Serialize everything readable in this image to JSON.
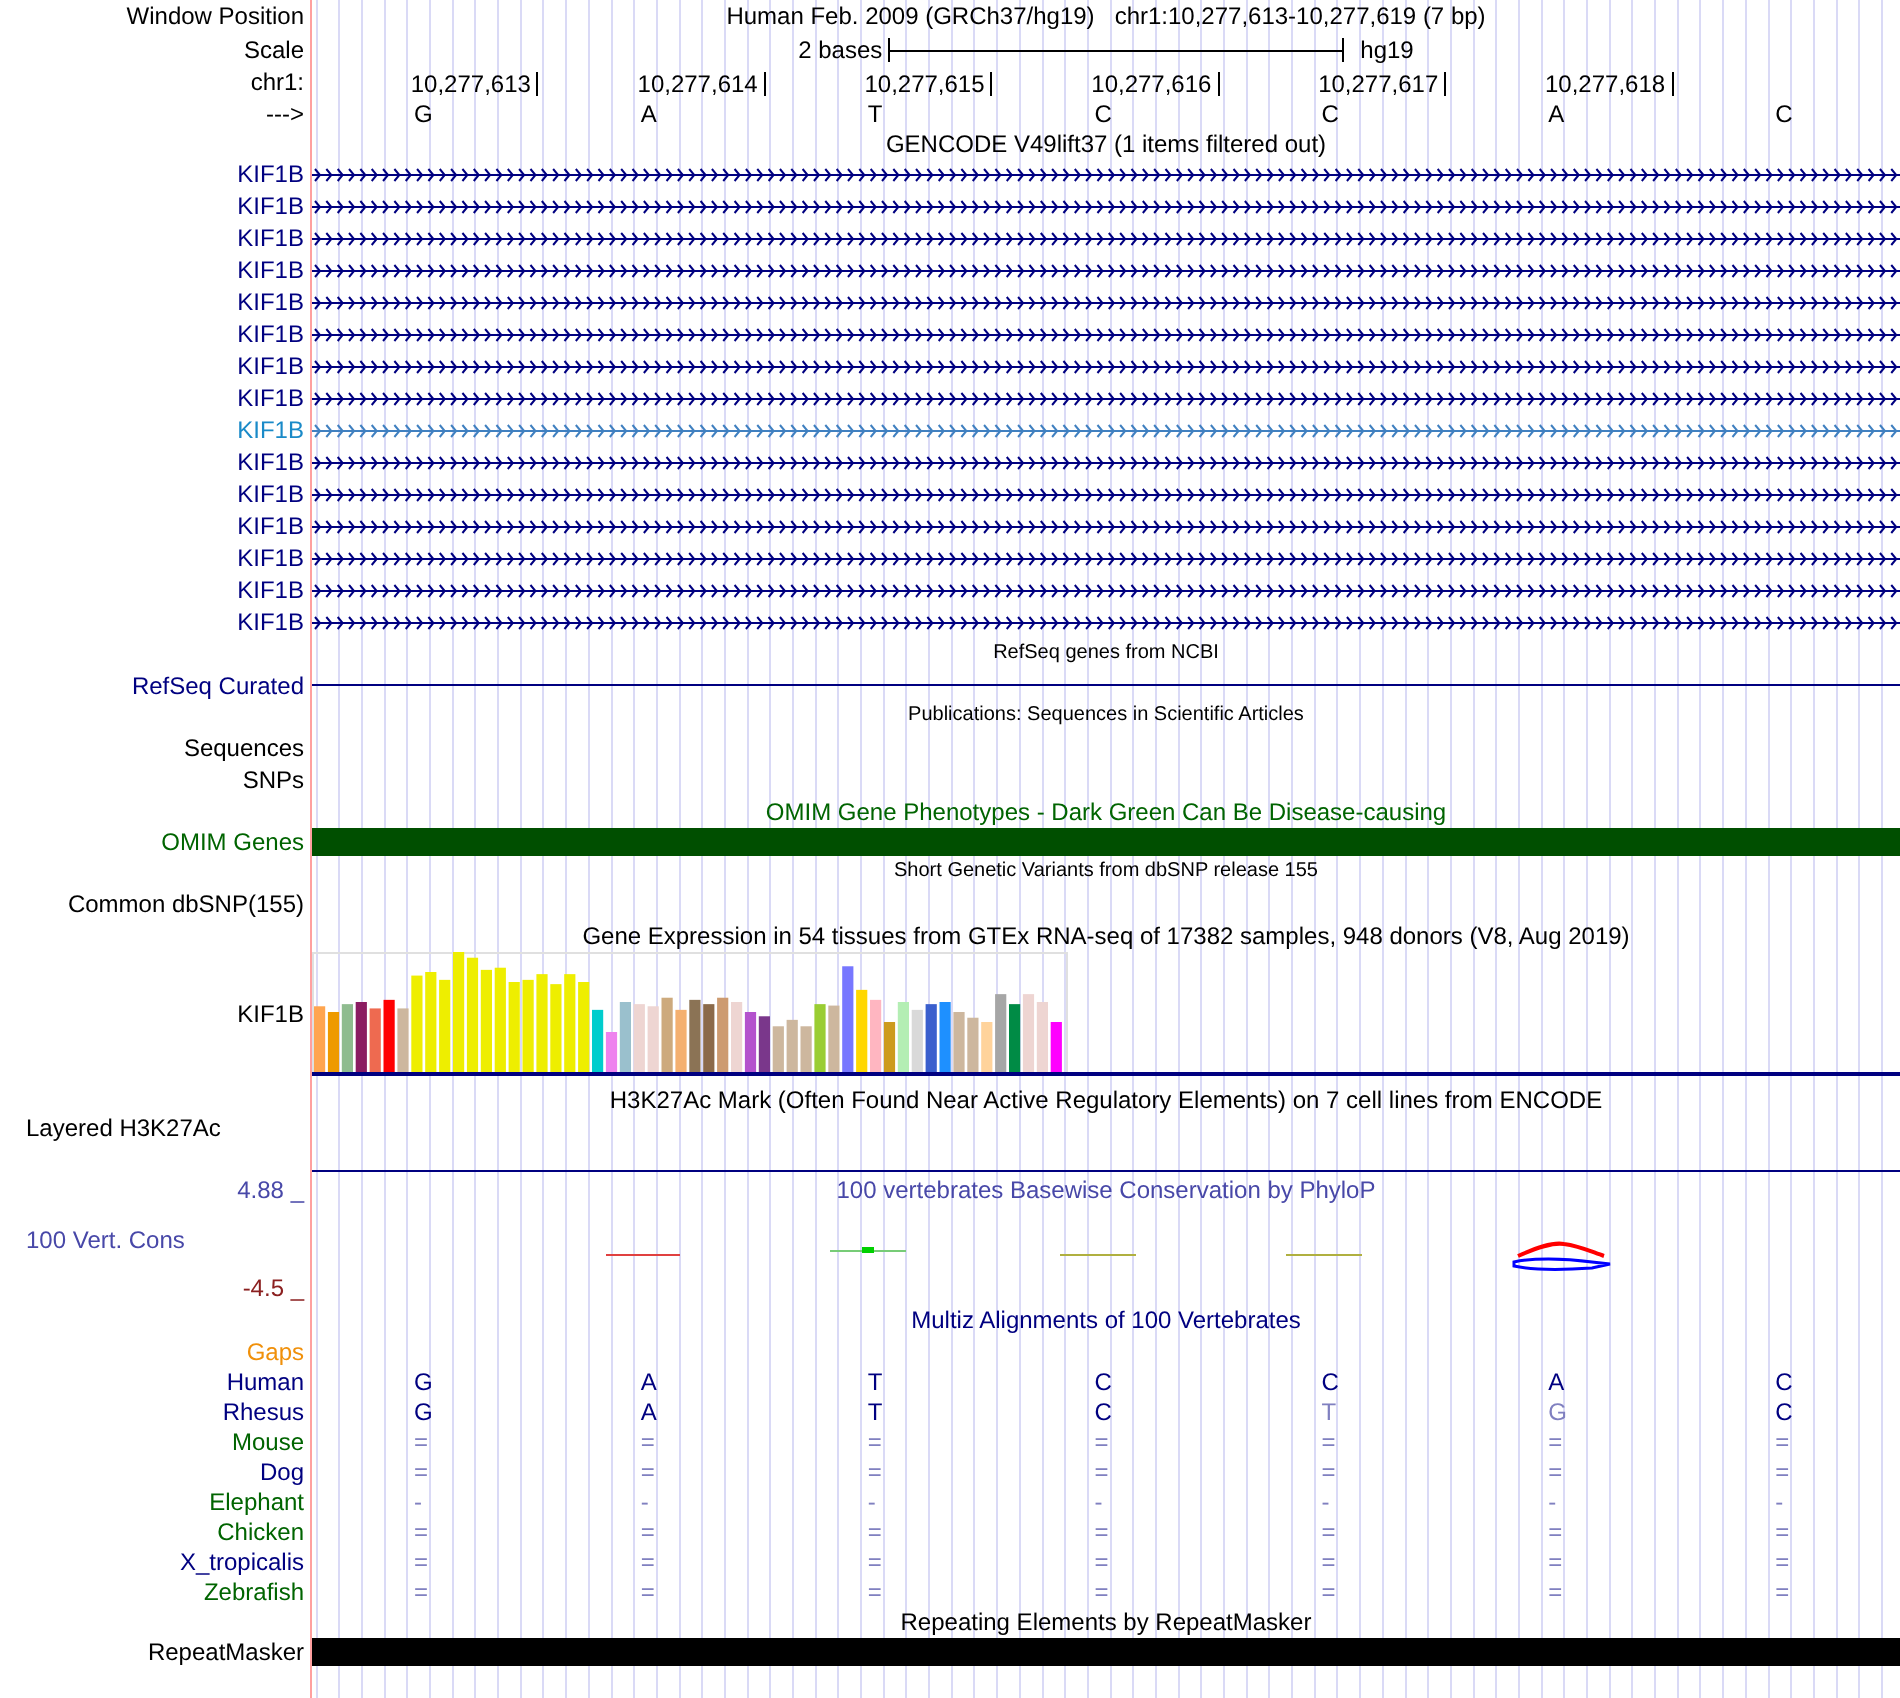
{
  "header": {
    "position_label": "Window Position",
    "assembly": "Human Feb. 2009 (GRCh37/hg19)",
    "position": "chr1:10,277,613-10,277,619 (7 bp)",
    "scale_label": "Scale",
    "scale_span": "2 bases",
    "scale_db": "hg19",
    "ruler_label": "chr1:",
    "ticks": [
      "10,277,613",
      "10,277,614",
      "10,277,615",
      "10,277,616",
      "10,277,617",
      "10,277,618"
    ],
    "strand_label": "--->",
    "bases": [
      "G",
      "A",
      "T",
      "C",
      "C",
      "A",
      "C"
    ]
  },
  "tracks": [
    {
      "kind": "genes",
      "title": "GENCODE V49lift37 (1 items filtered out)",
      "rows": [
        {
          "name": "KIF1B",
          "selected": false
        },
        {
          "name": "KIF1B",
          "selected": false
        },
        {
          "name": "KIF1B",
          "selected": false
        },
        {
          "name": "KIF1B",
          "selected": false
        },
        {
          "name": "KIF1B",
          "selected": false
        },
        {
          "name": "KIF1B",
          "selected": false
        },
        {
          "name": "KIF1B",
          "selected": false
        },
        {
          "name": "KIF1B",
          "selected": false
        },
        {
          "name": "KIF1B",
          "selected": true
        },
        {
          "name": "KIF1B",
          "selected": false
        },
        {
          "name": "KIF1B",
          "selected": false
        },
        {
          "name": "KIF1B",
          "selected": false
        },
        {
          "name": "KIF1B",
          "selected": false
        },
        {
          "name": "KIF1B",
          "selected": false
        },
        {
          "name": "KIF1B",
          "selected": false
        }
      ]
    },
    {
      "kind": "line",
      "title": "RefSeq genes from NCBI",
      "labels": [
        "RefSeq Curated"
      ]
    },
    {
      "kind": "labels",
      "title": "Publications: Sequences in Scientific Articles",
      "labels": [
        "Sequences",
        "SNPs"
      ]
    },
    {
      "kind": "bar",
      "title": "OMIM Gene Phenotypes - Dark Green Can Be Disease-causing",
      "labels": [
        "OMIM Genes"
      ]
    },
    {
      "kind": "empty",
      "title": "Short Genetic Variants from dbSNP release 155",
      "labels": [
        "Common dbSNP(155)"
      ]
    },
    {
      "kind": "expression",
      "title": "Gene Expression in 54 tissues from GTEx RNA-seq of 17382 samples, 948 donors (V8, Aug 2019)",
      "labels": [
        "KIF1B"
      ]
    },
    {
      "kind": "layered",
      "title": "H3K27Ac Mark (Often Found Near Active Regulatory Elements) on 7 cell lines from ENCODE",
      "labels": [
        "Layered H3K27Ac"
      ]
    },
    {
      "kind": "conservation",
      "title": "100 vertebrates Basewise Conservation by PhyloP",
      "labels": [
        "100 Vert. Cons"
      ],
      "max": "4.88 _",
      "min": "-4.5 _"
    },
    {
      "kind": "alignment",
      "title": "Multiz Alignments of 100 Vertebrates",
      "species": [
        {
          "name": "Gaps",
          "color": "#f0900a"
        },
        {
          "name": "Human",
          "color": "#000080",
          "bases": [
            {
              "b": "G",
              "faded": false
            },
            {
              "b": "A",
              "faded": false
            },
            {
              "b": "T",
              "faded": false
            },
            {
              "b": "C",
              "faded": false
            },
            {
              "b": "C",
              "faded": false
            },
            {
              "b": "A",
              "faded": false
            },
            {
              "b": "C",
              "faded": false
            }
          ]
        },
        {
          "name": "Rhesus",
          "color": "#000080",
          "bases": [
            {
              "b": "G",
              "faded": false
            },
            {
              "b": "A",
              "faded": false
            },
            {
              "b": "T",
              "faded": false
            },
            {
              "b": "C",
              "faded": false
            },
            {
              "b": "T",
              "faded": true
            },
            {
              "b": "G",
              "faded": true
            },
            {
              "b": "C",
              "faded": false
            }
          ]
        },
        {
          "name": "Mouse",
          "color": "#006400",
          "bases": [
            {
              "b": "=",
              "faded": true
            },
            {
              "b": "=",
              "faded": true
            },
            {
              "b": "=",
              "faded": true
            },
            {
              "b": "=",
              "faded": true
            },
            {
              "b": "=",
              "faded": true
            },
            {
              "b": "=",
              "faded": true
            },
            {
              "b": "=",
              "faded": true
            }
          ]
        },
        {
          "name": "Dog",
          "color": "#000080",
          "bases": [
            {
              "b": "=",
              "faded": true
            },
            {
              "b": "=",
              "faded": true
            },
            {
              "b": "=",
              "faded": true
            },
            {
              "b": "=",
              "faded": true
            },
            {
              "b": "=",
              "faded": true
            },
            {
              "b": "=",
              "faded": true
            },
            {
              "b": "=",
              "faded": true
            }
          ]
        },
        {
          "name": "Elephant",
          "color": "#006400",
          "bases": [
            {
              "b": "-",
              "faded": true
            },
            {
              "b": "-",
              "faded": true
            },
            {
              "b": "-",
              "faded": true
            },
            {
              "b": "-",
              "faded": true
            },
            {
              "b": "-",
              "faded": true
            },
            {
              "b": "-",
              "faded": true
            },
            {
              "b": "-",
              "faded": true
            }
          ]
        },
        {
          "name": "Chicken",
          "color": "#006400",
          "bases": [
            {
              "b": "=",
              "faded": true
            },
            {
              "b": "=",
              "faded": true
            },
            {
              "b": "=",
              "faded": true
            },
            {
              "b": "=",
              "faded": true
            },
            {
              "b": "=",
              "faded": true
            },
            {
              "b": "=",
              "faded": true
            },
            {
              "b": "=",
              "faded": true
            }
          ]
        },
        {
          "name": "X_tropicalis",
          "color": "#000080",
          "bases": [
            {
              "b": "=",
              "faded": true
            },
            {
              "b": "=",
              "faded": true
            },
            {
              "b": "=",
              "faded": true
            },
            {
              "b": "=",
              "faded": true
            },
            {
              "b": "=",
              "faded": true
            },
            {
              "b": "=",
              "faded": true
            },
            {
              "b": "=",
              "faded": true
            }
          ]
        },
        {
          "name": "Zebrafish",
          "color": "#006400",
          "bases": [
            {
              "b": "=",
              "faded": true
            },
            {
              "b": "=",
              "faded": true
            },
            {
              "b": "=",
              "faded": true
            },
            {
              "b": "=",
              "faded": true
            },
            {
              "b": "=",
              "faded": true
            },
            {
              "b": "=",
              "faded": true
            },
            {
              "b": "=",
              "faded": true
            }
          ]
        }
      ]
    },
    {
      "kind": "solid",
      "title": "Repeating Elements by RepeatMasker",
      "labels": [
        "RepeatMasker"
      ]
    }
  ]
}
